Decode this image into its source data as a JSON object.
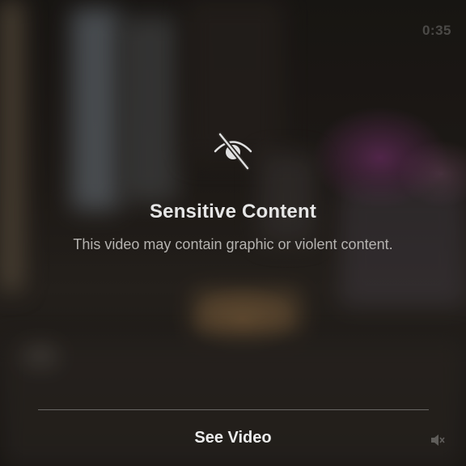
{
  "video": {
    "duration": "0:35"
  },
  "overlay": {
    "icon": "eye-slash-icon",
    "title": "Sensitive Content",
    "message": "This video may contain graphic or violent content.",
    "action_label": "See Video"
  },
  "controls": {
    "mute_icon": "speaker-muted-icon"
  },
  "colors": {
    "title": "#e6e6e6",
    "message": "#b5b3b0",
    "divider": "#5a5754"
  }
}
